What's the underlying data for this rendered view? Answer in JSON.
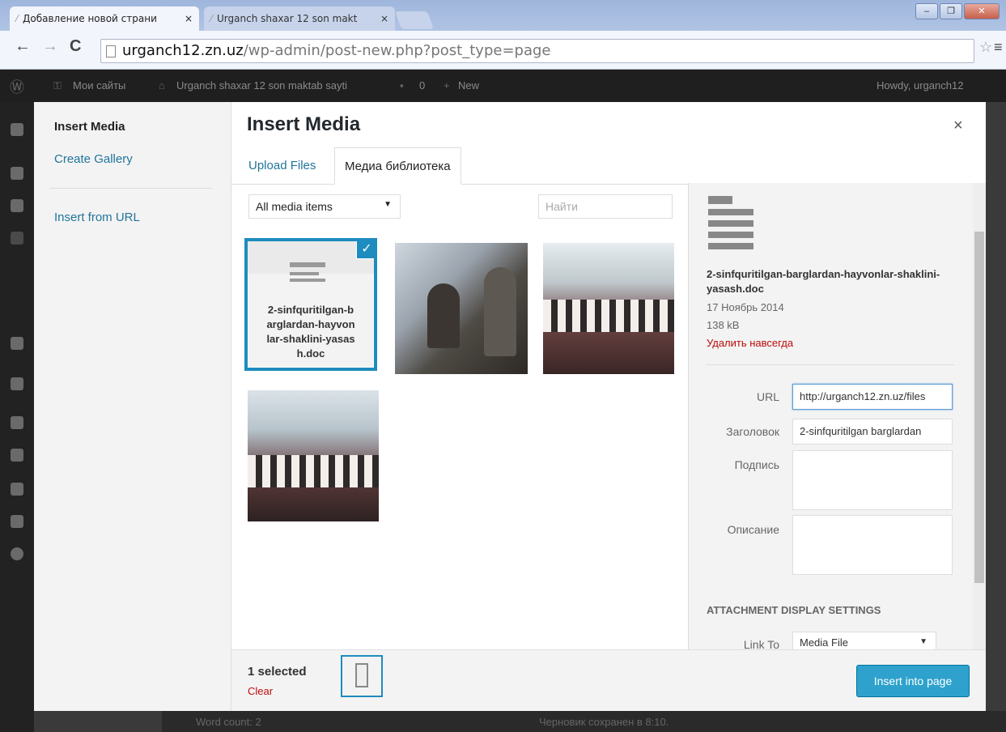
{
  "browser": {
    "tabs": [
      {
        "label": "Добавление новой страни",
        "close": "×"
      },
      {
        "label": "Urganch shaxar 12 son makt",
        "close": "×"
      }
    ],
    "url_host": "urganch12.zn.uz",
    "url_path": "/wp-admin/post-new.php?post_type=page"
  },
  "adminbar": {
    "my_sites": "Мои сайты",
    "site_name": "Urganch shaxar 12 son maktab sayti",
    "comments": "0",
    "new": "New",
    "howdy": "Howdy, urganch12"
  },
  "menu": {
    "title": "Insert Media",
    "create_gallery": "Create Gallery",
    "insert_url": "Insert from URL"
  },
  "frame": {
    "title": "Insert Media",
    "close": "×",
    "tabs": [
      "Upload Files",
      "Медиа библиотека"
    ],
    "filter": "All media items",
    "search_placeholder": "Найти"
  },
  "attachments": [
    {
      "type": "doc",
      "name": "2-sinfquritilgan-barglardan-hayvonlar-shaklini-yasash.doc",
      "selected": true
    },
    {
      "type": "image",
      "desc": "classroom photo"
    },
    {
      "type": "image",
      "desc": "group photo of students"
    },
    {
      "type": "image",
      "desc": "group photo of students"
    }
  ],
  "details": {
    "filename": "2-sinfquritilgan-barglardan-hayvonlar-shaklini-yasash.doc",
    "date": "17 Ноябрь 2014",
    "size": "138 kB",
    "delete": "Удалить навсегда",
    "url_label": "URL",
    "url_value": "http://urganch12.zn.uz/files",
    "title_label": "Заголовок",
    "title_value": "2-sinfquritilgan barglardan",
    "caption_label": "Подпись",
    "description_label": "Описание",
    "display_settings": "ATTACHMENT DISPLAY SETTINGS",
    "link_to_label": "Link To",
    "link_to_value": "Media File"
  },
  "toolbar": {
    "selected": "1 selected",
    "clear": "Clear",
    "insert": "Insert into page"
  },
  "statusbar": {
    "word_count": "Word count: 2",
    "draft_saved": "Черновик сохранен в 8:10."
  },
  "colors": {
    "accent": "#2ea2cc",
    "link": "#21759b",
    "danger": "#bc0b0b"
  }
}
